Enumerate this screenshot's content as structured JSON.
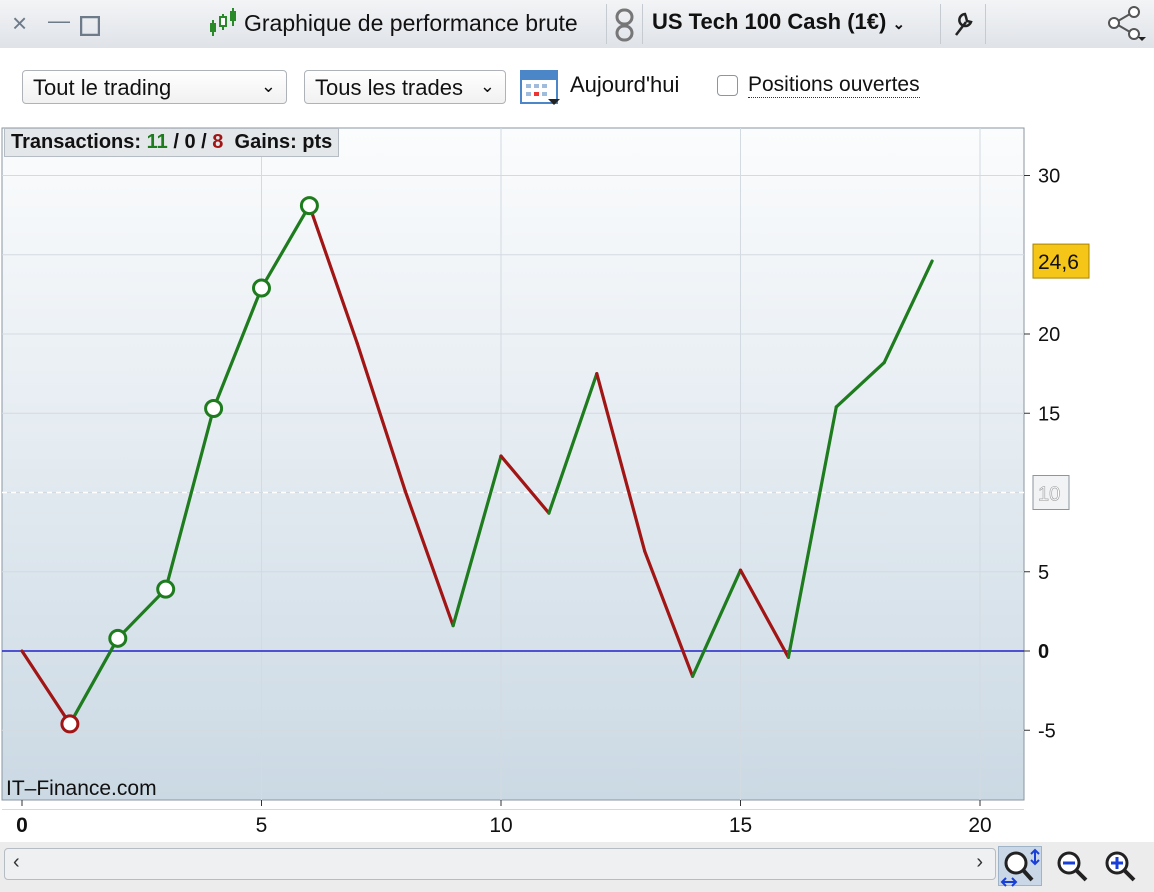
{
  "window": {
    "close_glyph": "×",
    "minimize_glyph": "—",
    "title": "Graphique de performance brute",
    "instrument": "US Tech 100 Cash (1€)"
  },
  "toolbar": {
    "period_select": "Tout le trading",
    "trades_select": "Tous les trades",
    "today_label": "Aujourd'hui",
    "positions_label": "Positions ouvertes",
    "positions_checked": false
  },
  "stats": {
    "transactions_label": "Transactions:",
    "wins": "11",
    "sep1": "/",
    "neutral": "0",
    "sep2": "/",
    "losses": "8",
    "gains_label": "Gains: pts"
  },
  "watermark": "IT–Finance.com",
  "colors": {
    "gain": "#1e7c1e",
    "loss": "#a11515",
    "zero_line": "#2323c8",
    "last_value_bg": "#f5c518"
  },
  "chart_data": {
    "type": "line",
    "x": [
      0,
      1,
      2,
      3,
      4,
      5,
      6,
      7,
      8,
      9,
      10,
      11,
      12,
      13,
      14,
      15,
      16,
      17,
      18,
      19
    ],
    "y": [
      0,
      -4.6,
      0.8,
      3.9,
      15.3,
      22.9,
      28.1,
      19.4,
      10.1,
      1.6,
      12.3,
      8.7,
      17.5,
      6.3,
      -1.6,
      5.1,
      -0.4,
      15.4,
      18.2,
      24.6
    ],
    "segment_colors": [
      "loss",
      "gain",
      "gain",
      "gain",
      "gain",
      "gain",
      "loss",
      "loss",
      "loss",
      "gain",
      "loss",
      "gain",
      "loss",
      "loss",
      "gain",
      "loss",
      "gain",
      "gain",
      "gain"
    ],
    "markers": [
      {
        "x": 1,
        "y": -4.6,
        "color": "loss"
      },
      {
        "x": 2,
        "y": 0.8,
        "color": "gain"
      },
      {
        "x": 3,
        "y": 3.9,
        "color": "gain"
      },
      {
        "x": 4,
        "y": 15.3,
        "color": "gain"
      },
      {
        "x": 5,
        "y": 22.9,
        "color": "gain"
      },
      {
        "x": 6,
        "y": 28.1,
        "color": "gain"
      }
    ],
    "xticks": [
      0,
      5,
      10,
      15,
      20
    ],
    "xtick_labels": [
      "0",
      "5",
      "10",
      "15",
      "20"
    ],
    "yticks": [
      -5,
      0,
      5,
      15,
      20,
      30
    ],
    "ytick_labels": [
      "-5",
      "0",
      "5",
      "15",
      "20",
      "30"
    ],
    "xlim": [
      0,
      21
    ],
    "ylim": [
      -9.5,
      33
    ],
    "reference_line": {
      "y": 10,
      "label": "10"
    },
    "last_value_label": "24,6",
    "last_value": 24.6,
    "grid": true
  }
}
